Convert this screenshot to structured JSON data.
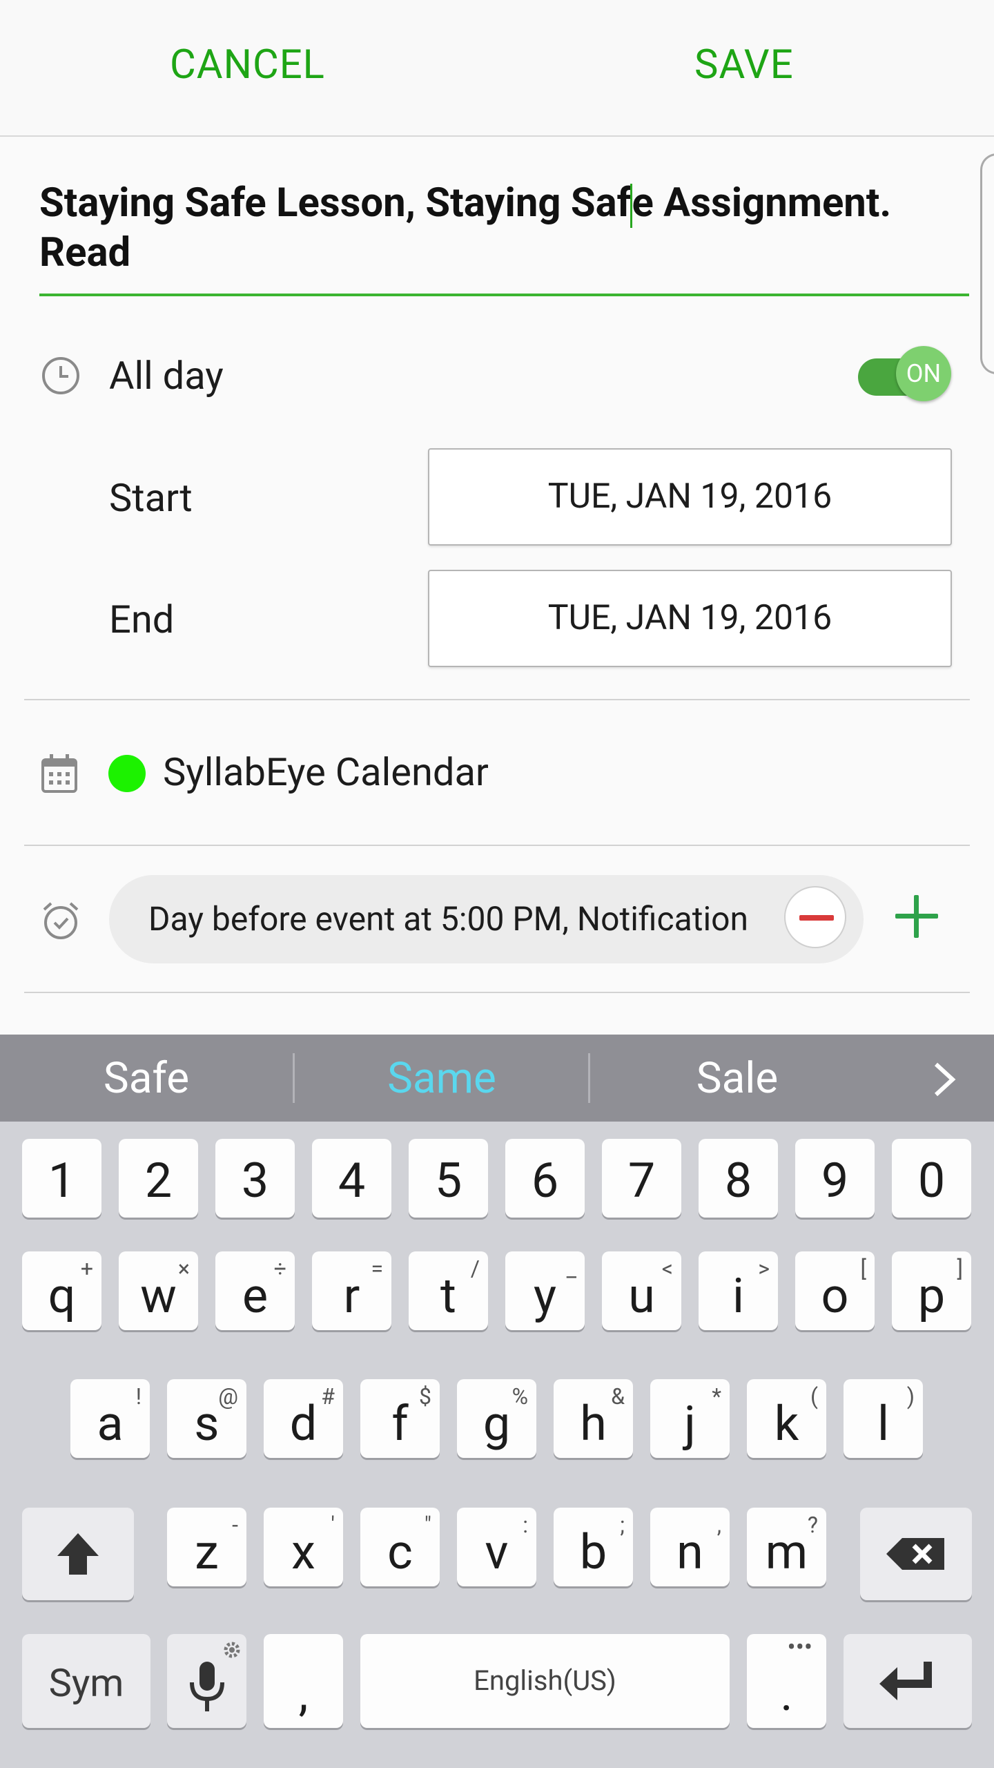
{
  "topbar": {
    "cancel": "CANCEL",
    "save": "SAVE"
  },
  "event": {
    "title_before_cursor": "Staying Safe Lesson, Staying Saf",
    "title_after_cursor": "e Assignment. Read"
  },
  "all_day": {
    "label": "All day",
    "toggle_text": "ON",
    "icon": "clock-icon"
  },
  "start": {
    "label": "Start",
    "value": "TUE, JAN 19, 2016"
  },
  "end": {
    "label": "End",
    "value": "TUE, JAN 19, 2016"
  },
  "calendar": {
    "name": "SyllabEye Calendar",
    "color": "#1cf200",
    "icon": "calendar-icon"
  },
  "reminder": {
    "text": "Day before event at 5:00 PM, Notification",
    "icon": "alarm-icon"
  },
  "keyboard": {
    "suggestions": [
      "Safe",
      "Same",
      "Sale"
    ],
    "highlight_color": "#5ad7ee",
    "numbers": [
      "1",
      "2",
      "3",
      "4",
      "5",
      "6",
      "7",
      "8",
      "9",
      "0"
    ],
    "row1": [
      [
        "q",
        "+"
      ],
      [
        "w",
        "×"
      ],
      [
        "e",
        "÷"
      ],
      [
        "r",
        "="
      ],
      [
        "t",
        "/"
      ],
      [
        "y",
        "_"
      ],
      [
        "u",
        "<"
      ],
      [
        "i",
        ">"
      ],
      [
        "o",
        "["
      ],
      [
        "p",
        "]"
      ]
    ],
    "row2": [
      [
        "a",
        "!"
      ],
      [
        "s",
        "@"
      ],
      [
        "d",
        "#"
      ],
      [
        "f",
        "$"
      ],
      [
        "g",
        "%"
      ],
      [
        "h",
        "&"
      ],
      [
        "j",
        "*"
      ],
      [
        "k",
        "("
      ],
      [
        "l",
        ")"
      ]
    ],
    "row3": [
      [
        "z",
        "-"
      ],
      [
        "x",
        "'"
      ],
      [
        "c",
        "\""
      ],
      [
        "v",
        ":"
      ],
      [
        "b",
        ";"
      ],
      [
        "n",
        ","
      ],
      [
        "m",
        "?"
      ]
    ],
    "sym_label": "Sym",
    "comma_label": ",",
    "space_label": "English(US)",
    "period_label": "."
  }
}
